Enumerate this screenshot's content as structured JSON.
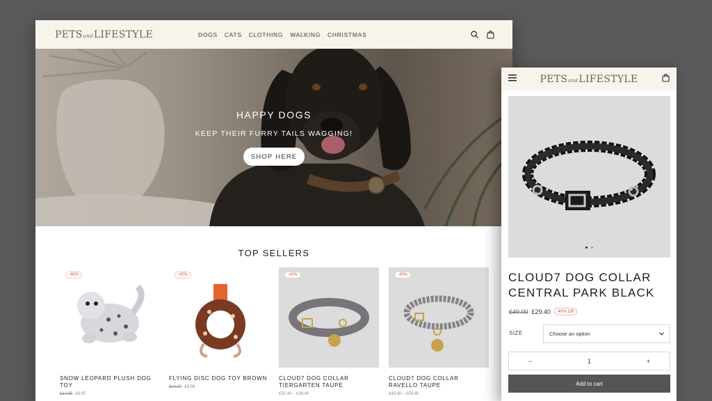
{
  "brand": {
    "logo_left": "PETS",
    "logo_amp": "and",
    "logo_right": "LIFESTYLE"
  },
  "nav": [
    "DOGS",
    "CATS",
    "CLOTHING",
    "WALKING",
    "CHRISTMAS"
  ],
  "hero": {
    "title": "HAPPY DOGS",
    "subtitle": "KEEP THEIR FURRY TAILS WAGGING!",
    "button": "SHOP HERE"
  },
  "top_sellers": {
    "title": "TOP SELLERS",
    "products": [
      {
        "badge": "-40%",
        "name": "SNOW LEOPARD PLUSH DOG TOY",
        "old_price": "£14.95",
        "price": "£8.97"
      },
      {
        "badge": "-40%",
        "name": "FLYING DISC DOG TOY BROWN",
        "old_price": "£14.30",
        "price": "£8.58"
      },
      {
        "badge": "-40%",
        "name": "CLOUD7 DOG COLLAR TIERGARTEN TAUPE",
        "price_range": "£32.40 – £38.40"
      },
      {
        "badge": "-40%",
        "name": "CLOUD7 DOG COLLAR RAVELLO TAUPE",
        "price_range": "£43.80 – £53.40"
      }
    ]
  },
  "product": {
    "title": "CLOUD7 DOG COLLAR CENTRAL PARK BLACK",
    "old_price": "£49.00",
    "price": "£29.40",
    "discount": "40% Off",
    "size_label": "SIZE",
    "size_placeholder": "Choose an option",
    "qty_minus": "−",
    "qty": "1",
    "qty_plus": "+",
    "add_to_cart": "Add to cart"
  },
  "colors": {
    "header_bg": "#f7f4ec",
    "button_dark": "#555555",
    "sale_red": "#d05a4e",
    "page_bg": "#5a5a5a"
  }
}
